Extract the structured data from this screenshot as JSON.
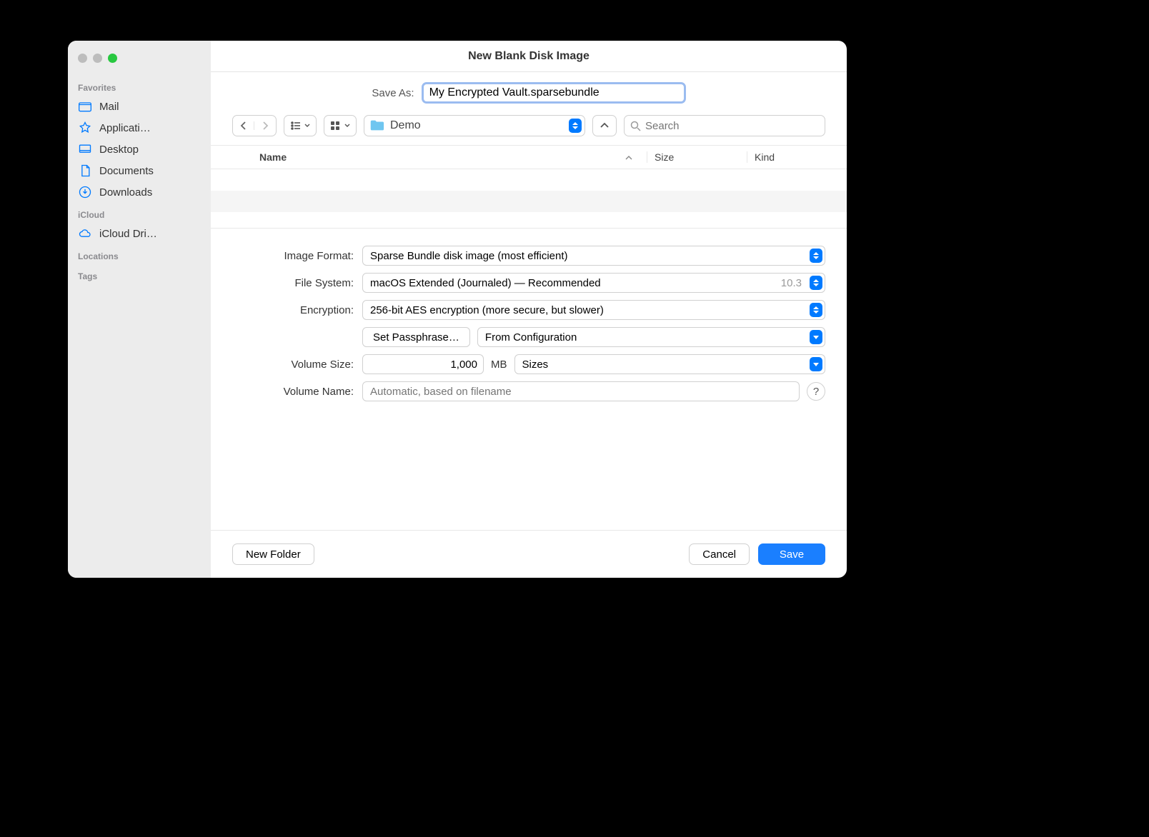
{
  "window": {
    "title": "New Blank Disk Image"
  },
  "save_as": {
    "label": "Save As:",
    "value": "My Encrypted Vault.sparsebundle"
  },
  "location": {
    "name": "Demo"
  },
  "search": {
    "placeholder": "Search"
  },
  "sidebar": {
    "sections": [
      {
        "header": "Favorites",
        "items": [
          {
            "label": "Mail",
            "icon": "folder-icon"
          },
          {
            "label": "Applicati…",
            "icon": "app-icon"
          },
          {
            "label": "Desktop",
            "icon": "desktop-icon"
          },
          {
            "label": "Documents",
            "icon": "document-icon"
          },
          {
            "label": "Downloads",
            "icon": "download-icon"
          }
        ]
      },
      {
        "header": "iCloud",
        "items": [
          {
            "label": "iCloud Dri…",
            "icon": "cloud-icon"
          }
        ]
      },
      {
        "header": "Locations",
        "items": []
      },
      {
        "header": "Tags",
        "items": []
      }
    ]
  },
  "columns": {
    "name": "Name",
    "size": "Size",
    "kind": "Kind"
  },
  "form": {
    "image_format": {
      "label": "Image Format:",
      "value": "Sparse Bundle disk image (most efficient)"
    },
    "file_system": {
      "label": "File System:",
      "value": "macOS Extended (Journaled) — Recommended",
      "hint": "10.3"
    },
    "encryption": {
      "label": "Encryption:",
      "value": "256-bit AES encryption (more secure, but slower)"
    },
    "set_passphrase": "Set Passphrase…",
    "passphrase_source": "From Configuration",
    "volume_size": {
      "label": "Volume Size:",
      "value": "1,000",
      "unit": "MB",
      "preset": "Sizes"
    },
    "volume_name": {
      "label": "Volume Name:",
      "placeholder": "Automatic, based on filename"
    }
  },
  "buttons": {
    "new_folder": "New Folder",
    "cancel": "Cancel",
    "save": "Save",
    "help": "?"
  }
}
